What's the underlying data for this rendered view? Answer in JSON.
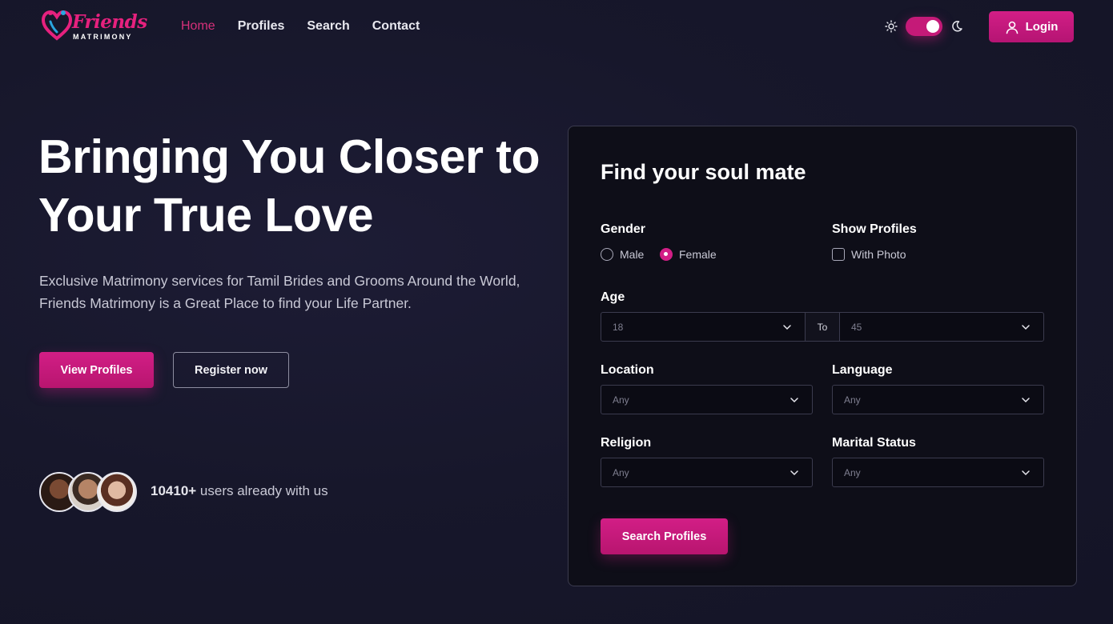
{
  "header": {
    "logo": {
      "word": "Friends",
      "sub": "MATRIMONY"
    },
    "nav": [
      {
        "label": "Home",
        "active": true
      },
      {
        "label": "Profiles",
        "active": false
      },
      {
        "label": "Search",
        "active": false
      },
      {
        "label": "Contact",
        "active": false
      }
    ],
    "theme": {
      "light_icon": "sun-icon",
      "dark_icon": "moon-icon",
      "mode": "dark"
    },
    "login_label": "Login"
  },
  "hero": {
    "title_line1": "Bringing You Closer to",
    "title_line2": "Your True Love",
    "desc_line1": "Exclusive Matrimony services for Tamil Brides and Grooms Around the World,",
    "desc_line2": "Friends Matrimony is a Great Place to find your Life Partner.",
    "primary_button": "View Profiles",
    "secondary_button": "Register now",
    "users_count": "10410+",
    "users_text": " users already with us"
  },
  "search_panel": {
    "title": "Find your soul mate",
    "gender_label": "Gender",
    "gender_options": [
      "Male",
      "Female"
    ],
    "gender_selected": "Female",
    "show_profiles_label": "Show Profiles",
    "with_photo_label": "With Photo",
    "with_photo_checked": false,
    "age_label": "Age",
    "age_from": "18",
    "age_to_label": "To",
    "age_to": "45",
    "location_label": "Location",
    "location_value": "Any",
    "language_label": "Language",
    "language_value": "Any",
    "religion_label": "Religion",
    "religion_value": "Any",
    "marital_label": "Marital Status",
    "marital_value": "Any",
    "search_button": "Search Profiles"
  },
  "colors": {
    "accent": "#d21e86",
    "background": "#17172b",
    "panel": "#0e0e18"
  }
}
